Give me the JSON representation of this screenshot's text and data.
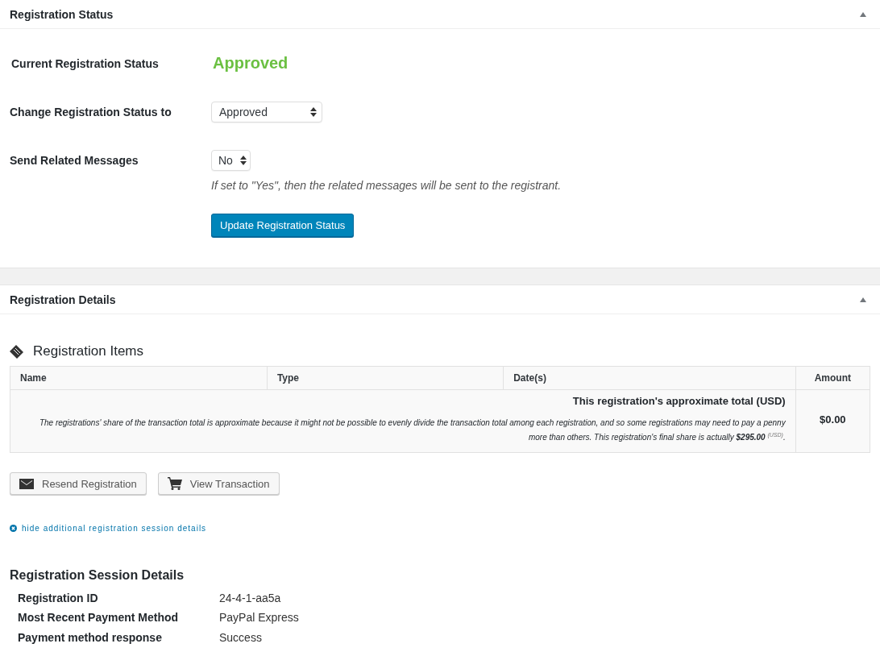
{
  "status_panel": {
    "title": "Registration Status",
    "expanded": true,
    "current_label": "Current Registration Status",
    "current_value": "Approved",
    "change_label": "Change Registration Status to",
    "change_value": "Approved",
    "send_label": "Send Related Messages",
    "send_value": "No",
    "send_hint": "If set to \"Yes\", then the related messages will be sent to the registrant.",
    "update_button": "Update Registration Status"
  },
  "details_panel": {
    "title": "Registration Details",
    "expanded": true,
    "items_heading": "Registration Items",
    "table": {
      "columns": [
        "Name",
        "Type",
        "Date(s)",
        "Amount"
      ],
      "total_label": "This registration's approximate total (USD)",
      "note": "The registrations' share of the transaction total is approximate because it might not be possible to evenly divide the transaction total among each registration, and so some registrations may need to pay a penny more than others. This registration's final share is actually **$295.00** $^{(USD)}$.",
      "amount": "$0.00"
    },
    "buttons": [
      {
        "label": "Resend Registration",
        "kind": "mail"
      },
      {
        "label": "View Transaction",
        "kind": "cart"
      }
    ],
    "toggle_link": "hide additional registration session details",
    "session": {
      "heading": "Registration Session Details",
      "rows": [
        {
          "label": "Registration ID",
          "value": "24-4-1-aa5a"
        },
        {
          "label": "Most Recent Payment Method",
          "value": "PayPal Express"
        },
        {
          "label": "Payment method response",
          "value": "Success"
        }
      ]
    }
  }
}
